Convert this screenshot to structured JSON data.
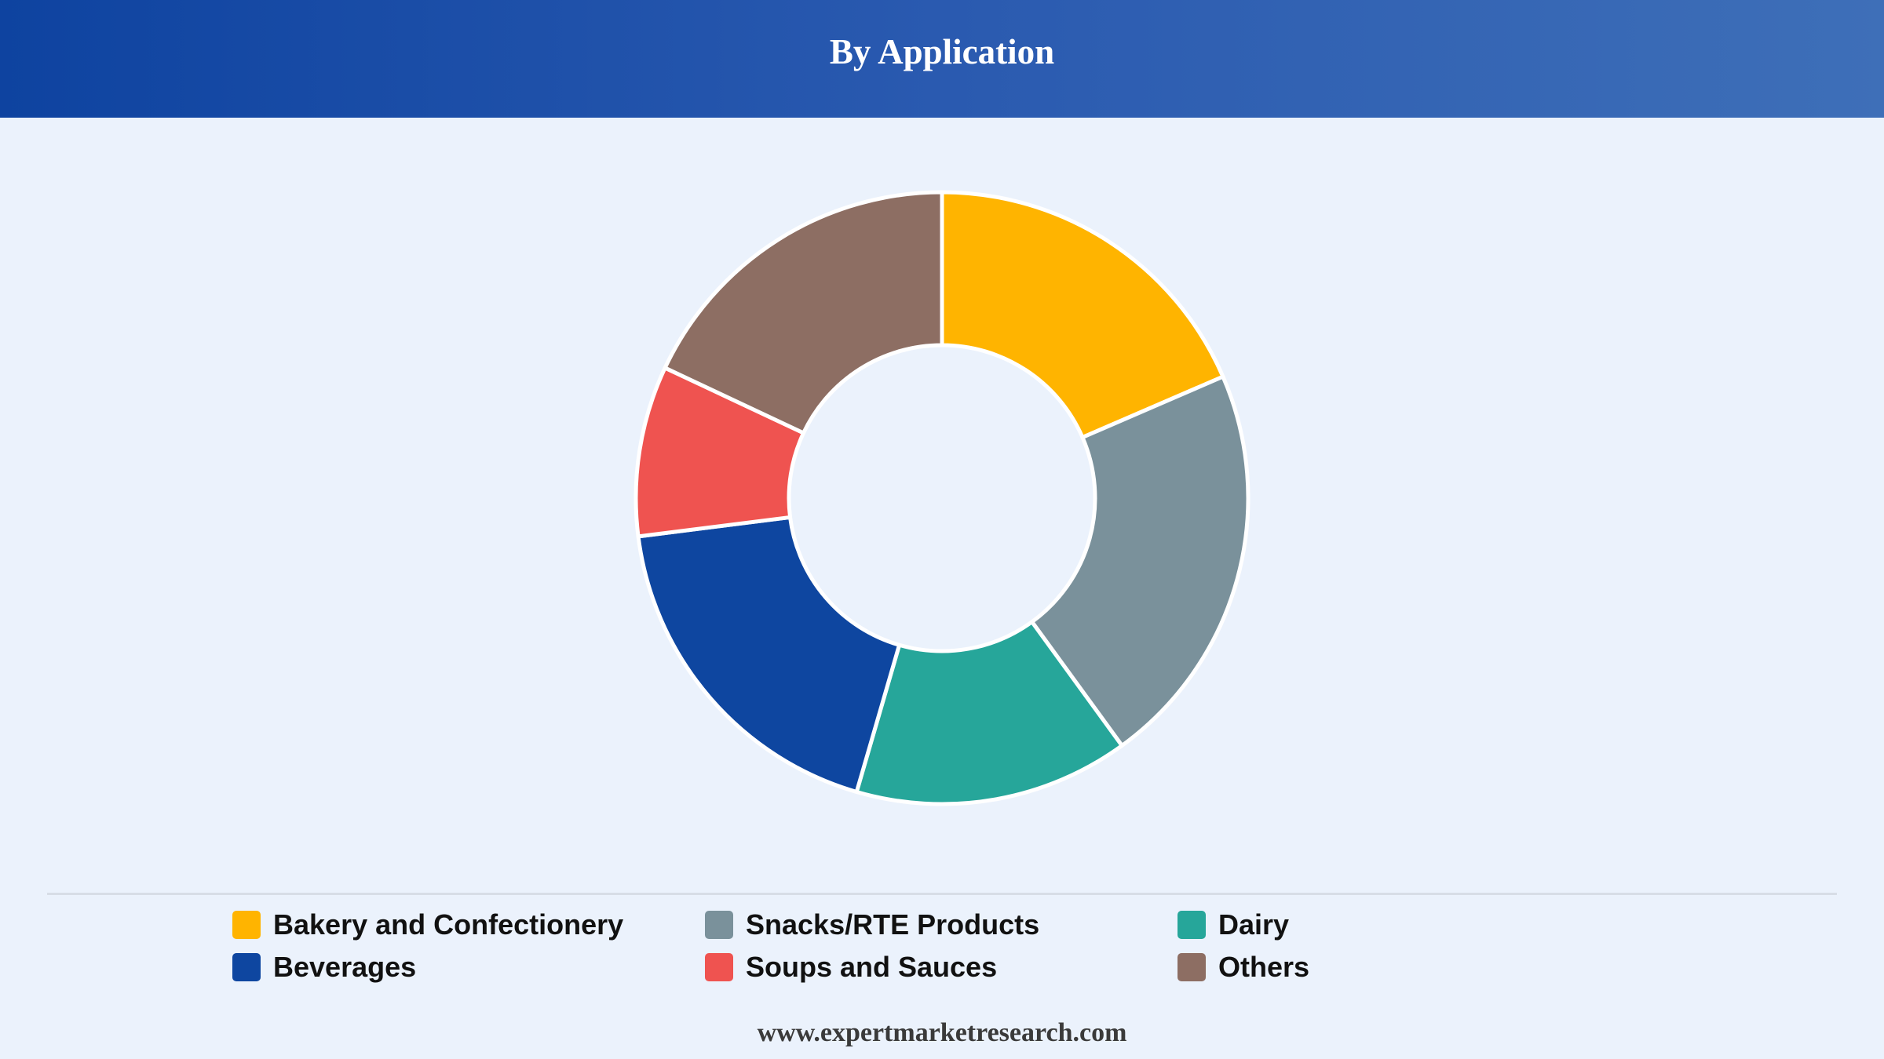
{
  "header": {
    "title": "By Application"
  },
  "chart_data": {
    "type": "pie",
    "style": "donut",
    "legend_position": "bottom",
    "categories": [
      "Bakery and Confectionery",
      "Snacks/RTE Products",
      "Dairy",
      "Beverages",
      "Soups and Sauces",
      "Others"
    ],
    "values": [
      18.5,
      21.5,
      14.5,
      18.5,
      9.0,
      18.0
    ],
    "colors": [
      "#ffb400",
      "#7a919b",
      "#26a69a",
      "#0e46a0",
      "#ef5350",
      "#8d6e63"
    ],
    "slice_order": [
      "Bakery and Confectionery",
      "Snacks/RTE Products",
      "Dairy",
      "Beverages",
      "Soups and Sauces",
      "Others"
    ]
  },
  "legend": {
    "items": [
      {
        "label": "Bakery and Confectionery",
        "color": "#ffb400"
      },
      {
        "label": "Snacks/RTE Products",
        "color": "#7a919b"
      },
      {
        "label": "Dairy",
        "color": "#26a69a"
      },
      {
        "label": "Beverages",
        "color": "#0e46a0"
      },
      {
        "label": "Soups and Sauces",
        "color": "#ef5350"
      },
      {
        "label": "Others",
        "color": "#8d6e63"
      }
    ]
  },
  "footer": {
    "source": "www.expertmarketresearch.com"
  }
}
